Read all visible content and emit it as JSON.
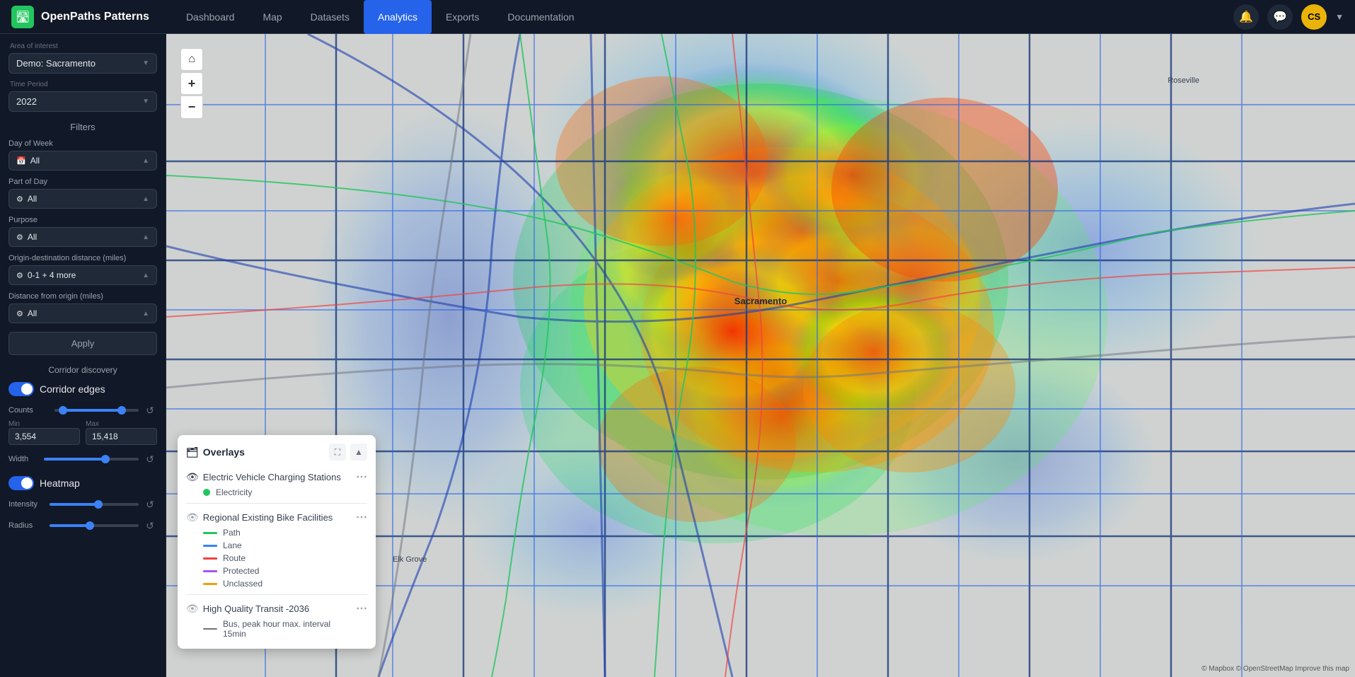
{
  "app": {
    "name": "OpenPaths Patterns",
    "logo_char": "🛣"
  },
  "nav": {
    "items": [
      {
        "label": "Dashboard",
        "active": false
      },
      {
        "label": "Map",
        "active": false
      },
      {
        "label": "Datasets",
        "active": false
      },
      {
        "label": "Analytics",
        "active": true
      },
      {
        "label": "Exports",
        "active": false
      },
      {
        "label": "Documentation",
        "active": false
      }
    ],
    "user_initials": "CS"
  },
  "sidebar": {
    "area_label": "Area of interest",
    "area_value": "Demo: Sacramento",
    "time_label": "Time Period",
    "time_value": "2022",
    "filters_title": "Filters",
    "day_of_week_label": "Day of Week",
    "day_of_week_value": "All",
    "part_of_day_label": "Part of Day",
    "part_of_day_value": "All",
    "purpose_label": "Purpose",
    "purpose_value": "All",
    "origin_dest_label": "Origin-destination distance (miles)",
    "origin_dest_value": "0-1 + 4 more",
    "dist_from_origin_label": "Distance from origin (miles)",
    "dist_from_origin_value": "All",
    "apply_label": "Apply",
    "corridor_discovery_title": "Corridor discovery",
    "corridor_edges_label": "Corridor edges",
    "counts_label": "Counts",
    "counts_min_label": "Min",
    "counts_min_value": "3,554",
    "counts_max_label": "Max",
    "counts_max_value": "15,418",
    "width_label": "Width",
    "heatmap_label": "Heatmap",
    "intensity_label": "Intensity",
    "radius_label": "Radius"
  },
  "overlays": {
    "title": "Overlays",
    "sections": [
      {
        "name": "Electric Vehicle Charging Stations",
        "visible": true,
        "legends": [
          {
            "label": "Electricity",
            "color": "#22c55e",
            "type": "dot"
          }
        ]
      },
      {
        "name": "Regional Existing Bike Facilities",
        "visible": false,
        "legends": [
          {
            "label": "Path",
            "color": "#22c55e",
            "type": "line"
          },
          {
            "label": "Lane",
            "color": "#3b82f6",
            "type": "line"
          },
          {
            "label": "Route",
            "color": "#ef4444",
            "type": "line"
          },
          {
            "label": "Protected",
            "color": "#a855f7",
            "type": "line"
          },
          {
            "label": "Unclassed",
            "color": "#f59e0b",
            "type": "line"
          }
        ]
      },
      {
        "name": "High Quality Transit -2036",
        "visible": false,
        "legends": [
          {
            "label": "Bus, peak hour max. interval 15min",
            "color": "#6b7280",
            "type": "line"
          }
        ]
      }
    ]
  },
  "map": {
    "zoom_in": "+",
    "zoom_out": "−",
    "home": "⌂"
  },
  "attribution": "© Mapbox © OpenStreetMap  Improve this map"
}
